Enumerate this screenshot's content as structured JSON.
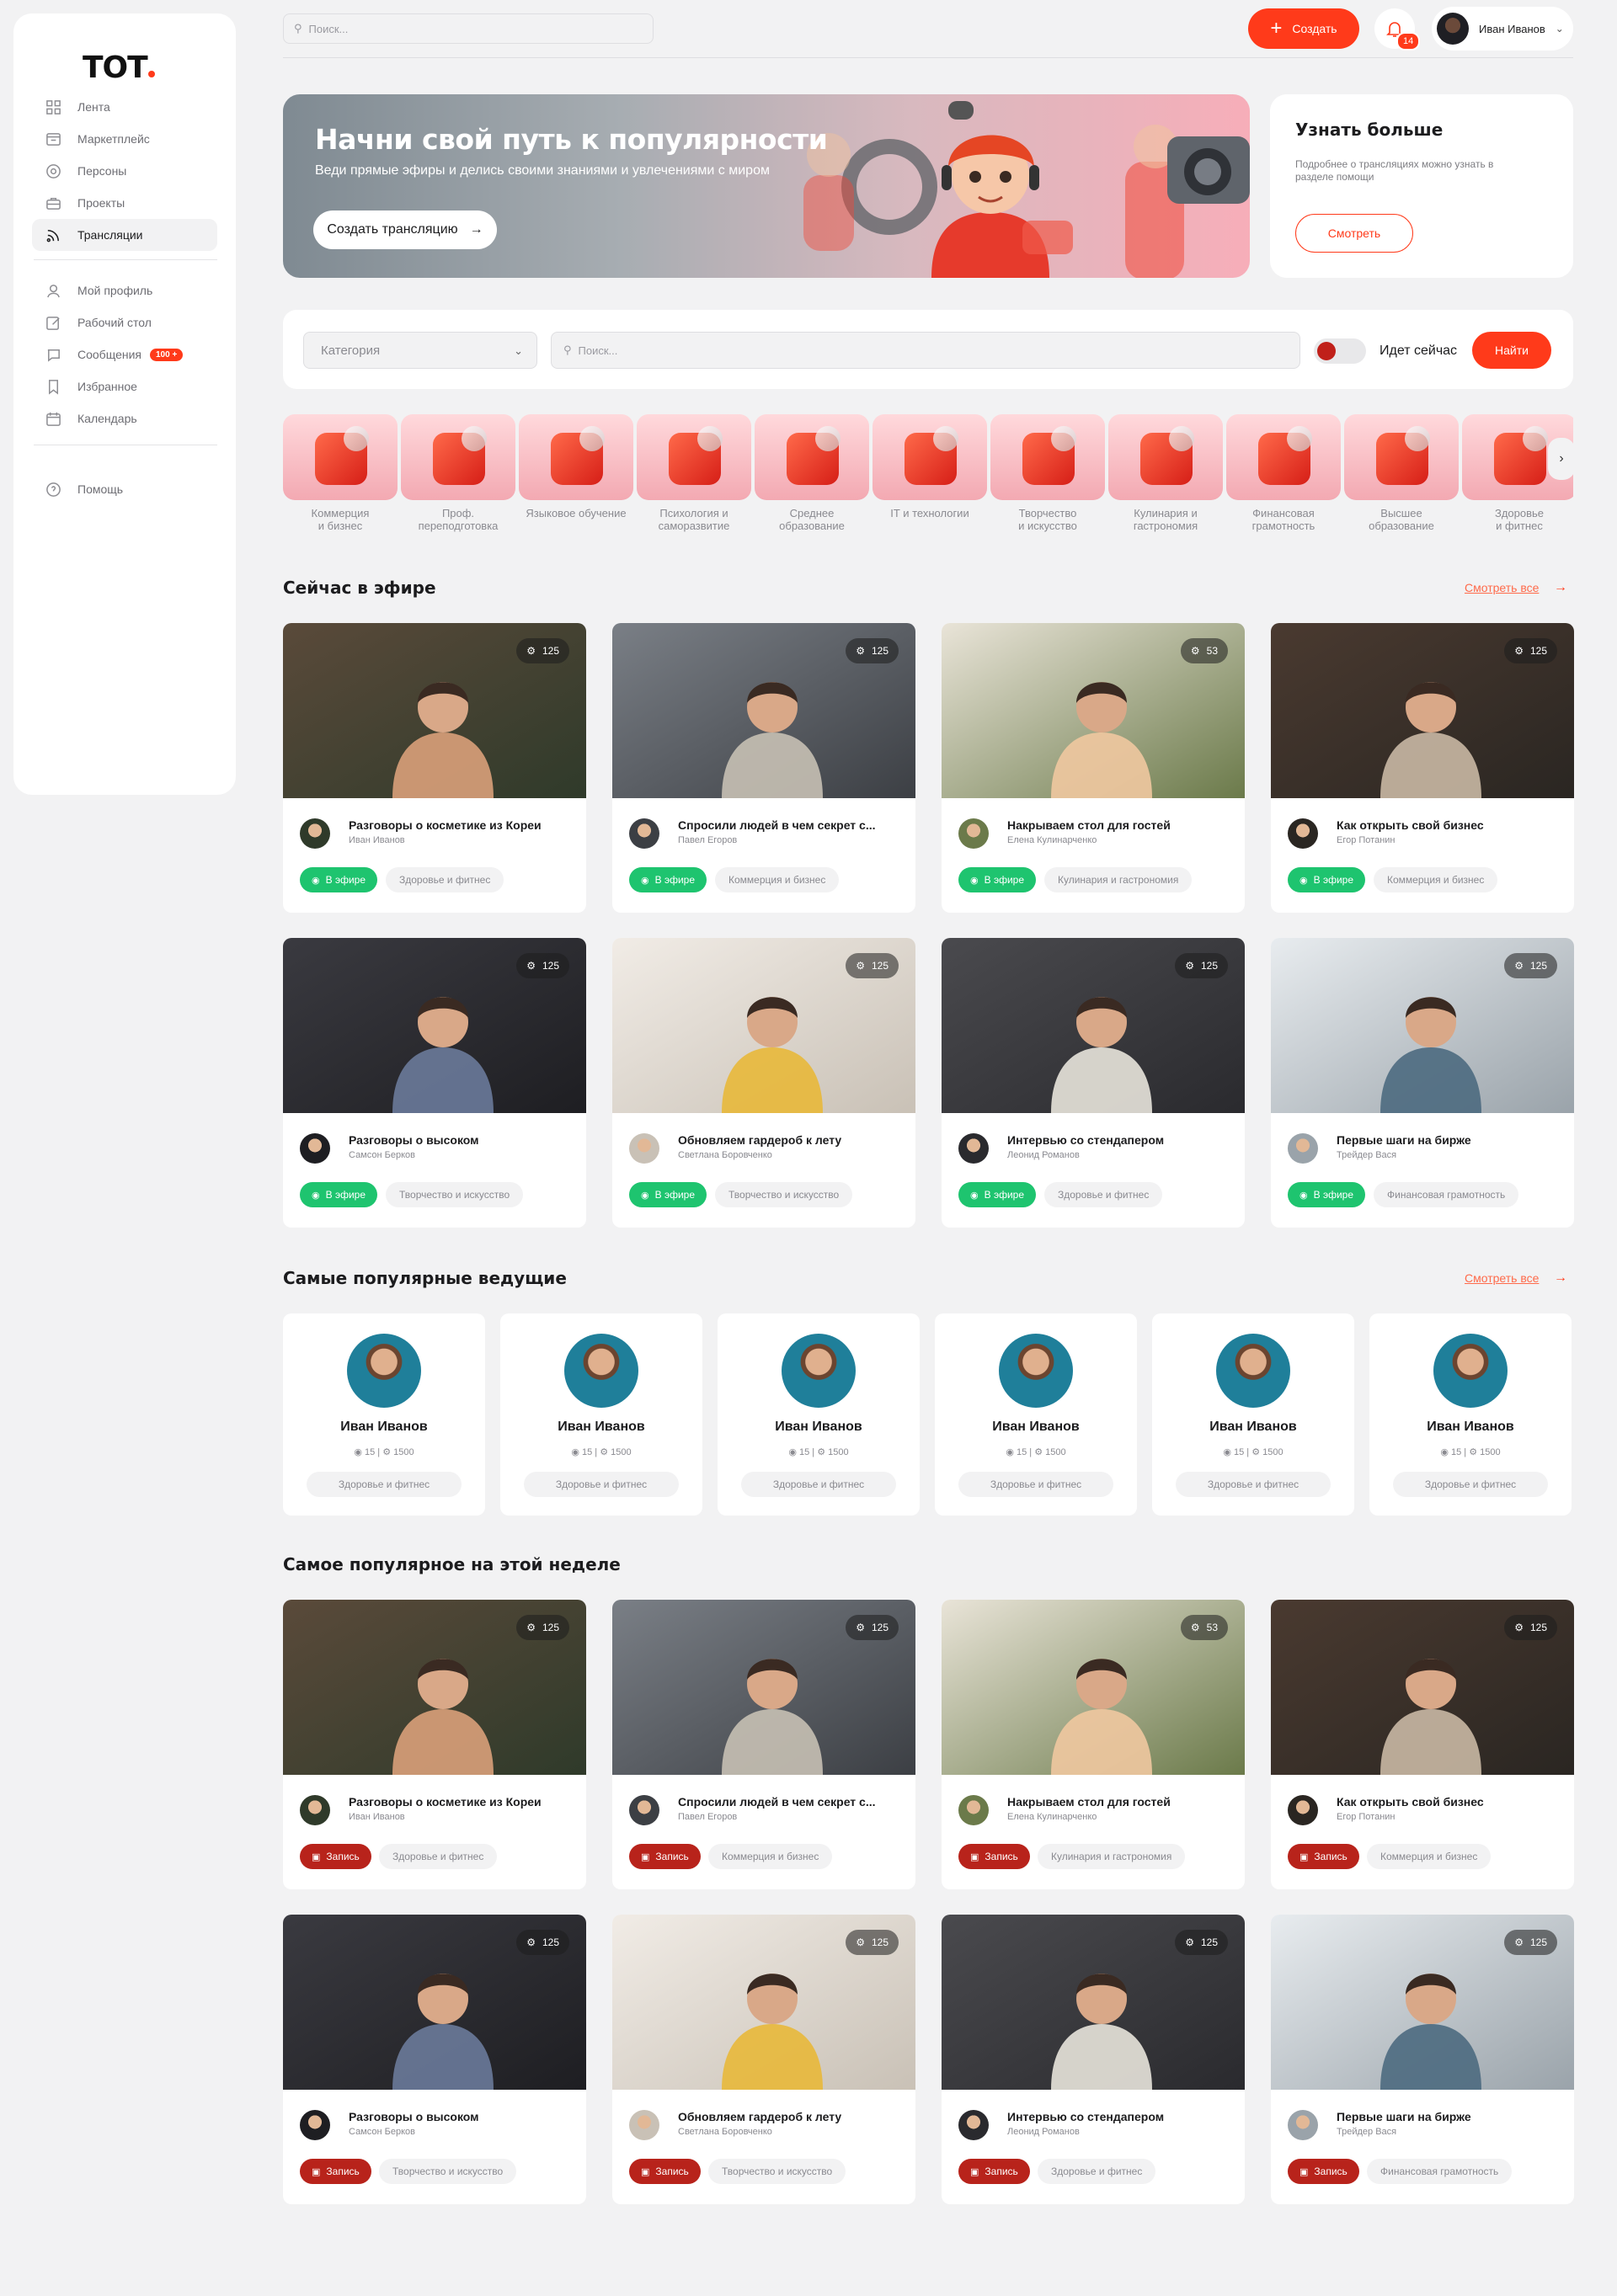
{
  "brand": {
    "logo": "ТОТ"
  },
  "sidebar": {
    "main": [
      {
        "label": "Лента",
        "icon": "grid-icon"
      },
      {
        "label": "Маркетплейс",
        "icon": "shop-icon"
      },
      {
        "label": "Персоны",
        "icon": "people-icon"
      },
      {
        "label": "Проекты",
        "icon": "briefcase-icon"
      },
      {
        "label": "Трансляции",
        "icon": "broadcast-icon",
        "active": true
      }
    ],
    "personal": [
      {
        "label": "Мой профиль",
        "icon": "user-icon"
      },
      {
        "label": "Рабочий стол",
        "icon": "edit-icon"
      },
      {
        "label": "Сообщения",
        "icon": "chat-icon",
        "badge": "100 +"
      },
      {
        "label": "Избранное",
        "icon": "bookmark-icon"
      },
      {
        "label": "Календарь",
        "icon": "calendar-icon"
      }
    ],
    "help": {
      "label": "Помощь",
      "icon": "help-icon"
    }
  },
  "topbar": {
    "search_placeholder": "Поиск...",
    "create_label": "Создать",
    "notifications_count": "14",
    "user_name": "Иван Иванов"
  },
  "hero": {
    "title": "Начни свой путь к популярности",
    "subtitle": "Веди прямые эфиры и делись своими знаниями и увлечениями с миром",
    "button": "Создать трансляцию"
  },
  "learn_more": {
    "title": "Узнать больше",
    "text": "Подробнее о трансляциях можно узнать в разделе помощи",
    "button": "Смотреть"
  },
  "filters": {
    "category_placeholder": "Категория",
    "search_placeholder": "Поиск...",
    "live_toggle_label": "Идет сейчас",
    "find_button": "Найти"
  },
  "categories": [
    "Коммерция\nи бизнес",
    "Проф.\nпереподготовка",
    "Языковое обучение",
    "Психология и\nсаморазвитие",
    "Среднее\nобразование",
    "IT и технологии",
    "Творчество\nи искусство",
    "Кулинария и\nгастрономия",
    "Финансовая\nграмотность",
    "Высшее\nобразование",
    "Здоровье\nи фитнес"
  ],
  "sections": {
    "live_title": "Сейчас в эфире",
    "hosts_title": "Самые популярные ведущие",
    "week_title": "Самое популярное на этой неделе",
    "see_all": "Смотреть все"
  },
  "status_labels": {
    "live": "В эфире",
    "rec": "Запись"
  },
  "streams": [
    {
      "title": "Разговоры о косметике из Кореи",
      "author": "Иван Иванов",
      "views": "125",
      "tag": "Здоровье и фитнес"
    },
    {
      "title": "Спросили людей в чем секрет с...",
      "author": "Павел Егоров",
      "views": "125",
      "tag": "Коммерция и бизнес"
    },
    {
      "title": "Накрываем стол для гостей",
      "author": "Елена Кулинарченко",
      "views": "53",
      "tag": "Кулинария и гастрономия"
    },
    {
      "title": "Как открыть свой бизнес",
      "author": "Егор Потанин",
      "views": "125",
      "tag": "Коммерция и бизнес"
    },
    {
      "title": "Разговоры о высоком",
      "author": "Самсон Берков",
      "views": "125",
      "tag": "Творчество и искусство"
    },
    {
      "title": "Обновляем гардероб к лету",
      "author": "Светлана Боровченко",
      "views": "125",
      "tag": "Творчество и искусство"
    },
    {
      "title": "Интервью со стендапером",
      "author": "Леонид Романов",
      "views": "125",
      "tag": "Здоровье и фитнес"
    },
    {
      "title": "Первые шаги на бирже",
      "author": "Трейдер Вася",
      "views": "125",
      "tag": "Финансовая грамотность"
    }
  ],
  "hosts": [
    {
      "name": "Иван Иванов",
      "streams": "15",
      "followers": "1500",
      "tag": "Здоровье и фитнес"
    },
    {
      "name": "Иван Иванов",
      "streams": "15",
      "followers": "1500",
      "tag": "Здоровье и фитнес"
    },
    {
      "name": "Иван Иванов",
      "streams": "15",
      "followers": "1500",
      "tag": "Здоровье и фитнес"
    },
    {
      "name": "Иван Иванов",
      "streams": "15",
      "followers": "1500",
      "tag": "Здоровье и фитнес"
    },
    {
      "name": "Иван Иванов",
      "streams": "15",
      "followers": "1500",
      "tag": "Здоровье и фитнес"
    },
    {
      "name": "Иван Иванов",
      "streams": "15",
      "followers": "1500",
      "tag": "Здоровье и фитнес"
    }
  ],
  "colors": {
    "accent": "#ff3a1a",
    "live": "#1ec46f",
    "record": "#b8231b"
  }
}
